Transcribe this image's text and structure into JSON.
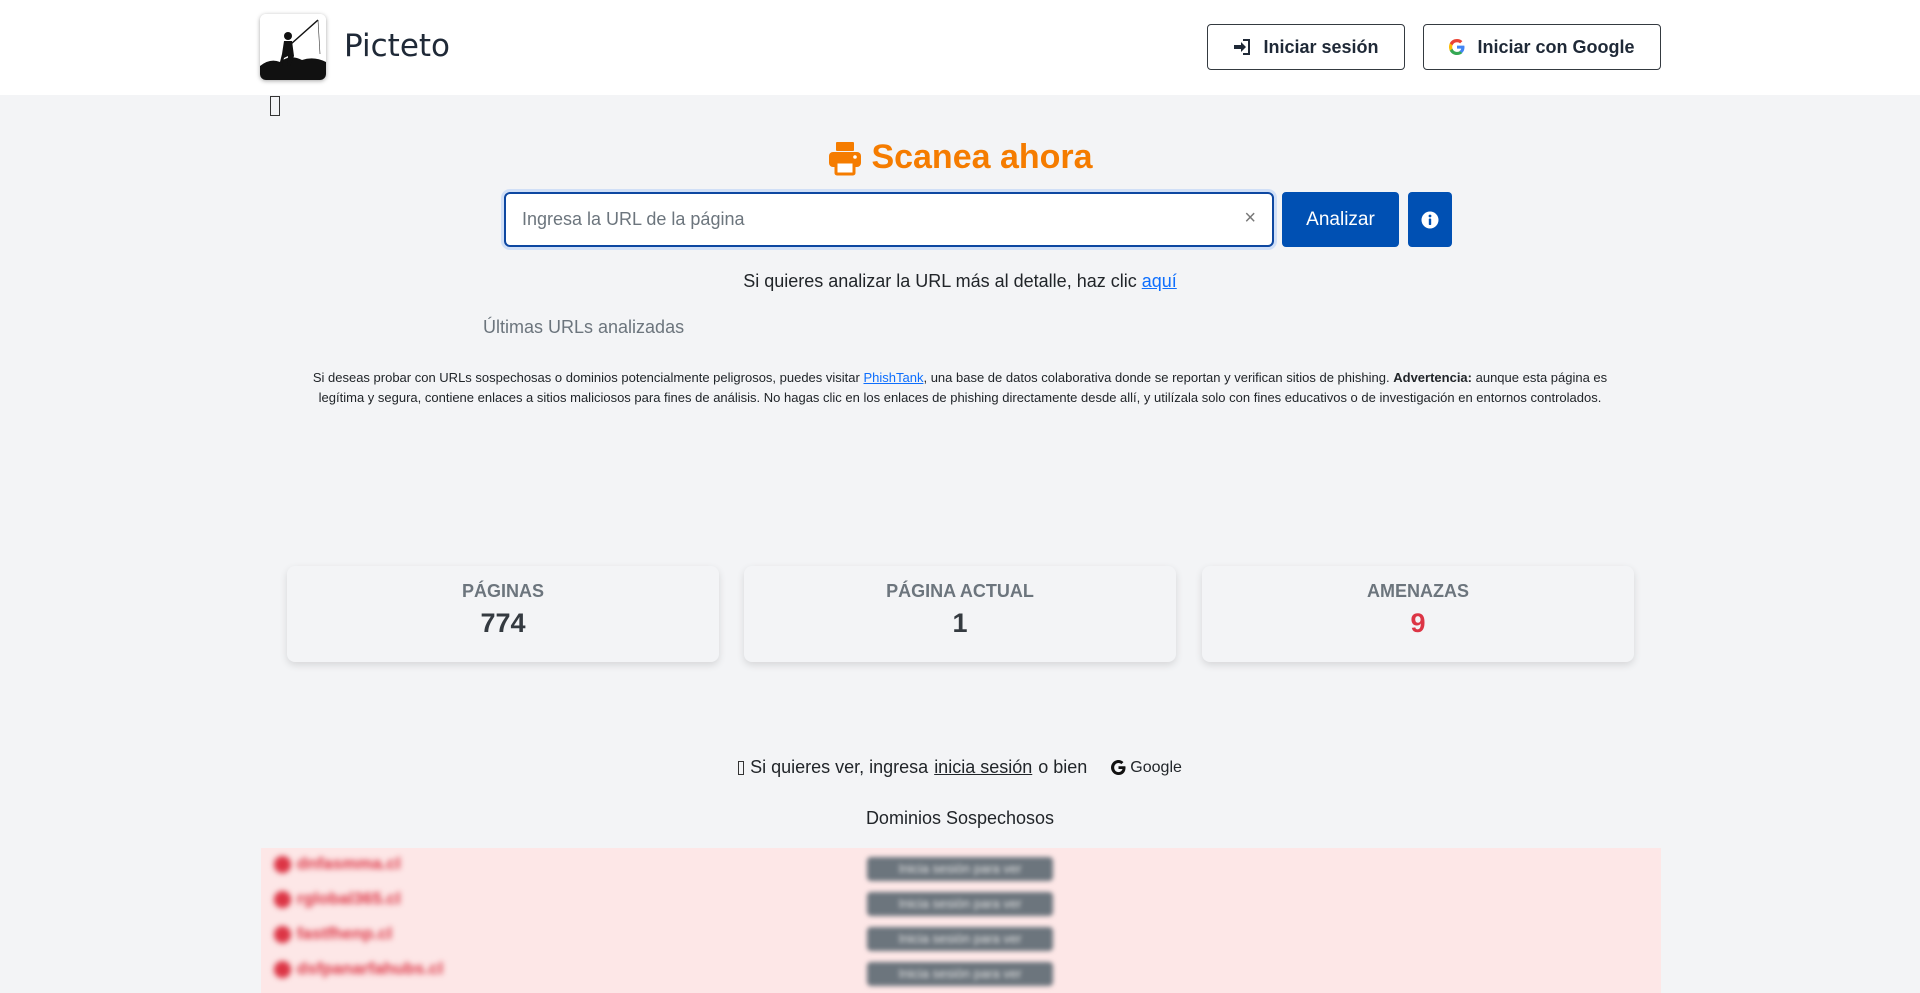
{
  "header": {
    "brand": "Picteto",
    "login_label": "Iniciar sesión",
    "google_login_label": "Iniciar con Google"
  },
  "scan": {
    "title": "Scanea ahora",
    "url_placeholder": "Ingresa la URL de la página",
    "url_value": "",
    "clear_symbol": "×",
    "analyze_label": "Analizar",
    "detail_text": "Si quieres analizar la URL más al detalle, haz clic",
    "detail_link": "aquí",
    "last_urls_label": "Últimas URLs analizadas"
  },
  "notice": {
    "text_before": "Si deseas probar con URLs sospechosas o dominios potencialmente peligrosos, puedes visitar",
    "link": "PhishTank",
    "text_after": ", una base de datos colaborativa donde se reportan y verifican sitios de phishing.",
    "warning_label": "Advertencia:",
    "warning_text": "aunque esta página es legítima y segura, contiene enlaces a sitios maliciosos para fines de análisis. No hagas clic en los enlaces de phishing directamente desde allí, y utilízala solo con fines educativos o de investigación en entornos controlados."
  },
  "stats": [
    {
      "label": "PÁGINAS",
      "value": "774"
    },
    {
      "label": "PÁGINA ACTUAL",
      "value": "1"
    },
    {
      "label": "AMENAZAS",
      "value": "9"
    }
  ],
  "login_hint": {
    "text_before": "Si quieres ver, ingresa",
    "link": "inicia sesión",
    "text_middle": "o bien",
    "google_label": "Google"
  },
  "suspicious": {
    "title": "Dominios Sospechosos",
    "rows": [
      {
        "domain": "dnfasmma.cl",
        "badge": "Inicia sesión para ver"
      },
      {
        "domain": "rglobal365.cl",
        "badge": "Inicia sesión para ver"
      },
      {
        "domain": "fastfhenp.cl",
        "badge": "Inicia sesión para ver"
      },
      {
        "domain": "dsfpanarfahubs.cl",
        "badge": "Inicia sesión para ver"
      }
    ]
  },
  "colors": {
    "accent_orange": "#f57c00",
    "primary_blue": "#0050b3",
    "danger": "#dc3545"
  }
}
